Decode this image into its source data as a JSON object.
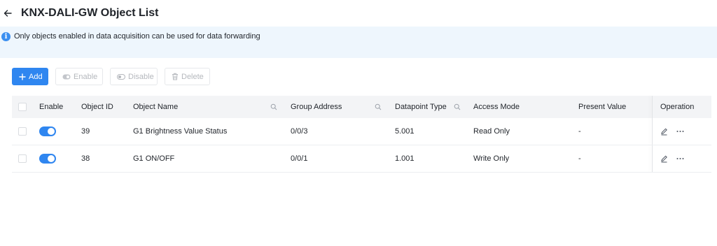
{
  "header": {
    "title": "KNX-DALI-GW Object List",
    "back_icon": "arrow-left-icon"
  },
  "notice": {
    "text": "Only objects enabled in data acquisition can be used for data forwarding",
    "icon": "info-icon"
  },
  "toolbar": {
    "add_label": "Add",
    "enable_label": "Enable",
    "disable_label": "Disable",
    "delete_label": "Delete"
  },
  "table": {
    "columns": {
      "enable": "Enable",
      "object_id": "Object ID",
      "object_name": "Object Name",
      "group_address": "Group Address",
      "datapoint_type": "Datapoint Type",
      "access_mode": "Access Mode",
      "present_value": "Present Value",
      "operation": "Operation"
    },
    "rows": [
      {
        "enabled": true,
        "object_id": "39",
        "object_name": "G1 Brightness Value Status",
        "group_address": "0/0/3",
        "datapoint_type": "5.001",
        "access_mode": "Read Only",
        "present_value": "-"
      },
      {
        "enabled": true,
        "object_id": "38",
        "object_name": "G1 ON/OFF",
        "group_address": "0/0/1",
        "datapoint_type": "1.001",
        "access_mode": "Write Only",
        "present_value": "-"
      }
    ]
  },
  "colors": {
    "accent": "#2f86f0",
    "notice_bg": "#eef6fd",
    "header_bg": "#f3f4f6"
  }
}
